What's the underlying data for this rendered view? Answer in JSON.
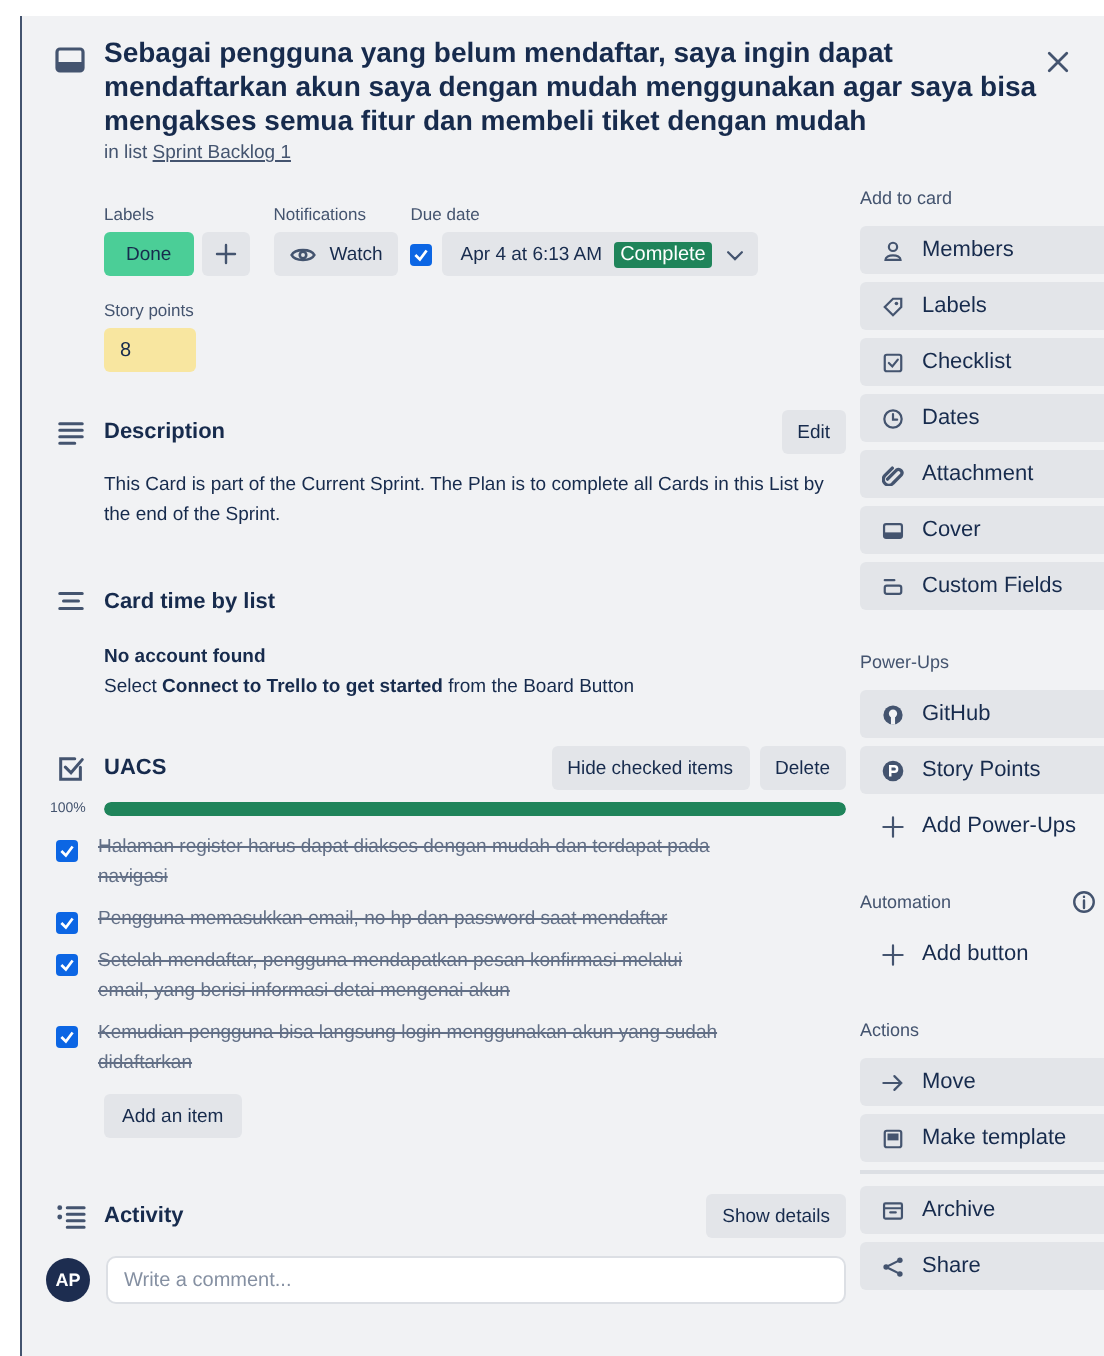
{
  "card": {
    "title": "Sebagai pengguna yang belum mendaftar, saya ingin dapat mendaftarkan akun saya dengan mudah menggunakan agar saya bisa mengakses semua fitur dan membeli tiket dengan mudah",
    "list_prefix": "in list",
    "list_name": "Sprint Backlog 1"
  },
  "labels": {
    "heading": "Labels",
    "items": [
      {
        "text": "Done",
        "color": "#4bce97"
      }
    ]
  },
  "notifications": {
    "heading": "Notifications",
    "button": "Watch"
  },
  "due_date": {
    "heading": "Due date",
    "checked": true,
    "value": "Apr 4 at 6:13 AM",
    "status": "Complete"
  },
  "story_points": {
    "heading": "Story points",
    "value": "8"
  },
  "description": {
    "heading": "Description",
    "button": "Edit",
    "text": "This Card is part of the Current Sprint. The Plan is to complete all Cards in this List by the end of the Sprint."
  },
  "card_time": {
    "heading": "Card time by list",
    "title": "No account found",
    "text": "Select **Connect to Trello to get started** from the Board Button"
  },
  "checklist": {
    "heading": "UACS",
    "buttons": [
      "Hide checked items",
      "Delete"
    ],
    "percent": "100%",
    "level": 1,
    "add_button": "Add an item",
    "items": [
      {
        "text": "Halaman register harus dapat diakses dengan mudah dan terdapat pada navigasi",
        "checked": true
      },
      {
        "text": "Pengguna memasukkan email, no hp dan password saat mendaftar",
        "checked": true
      },
      {
        "text": "Setelah mendaftar, pengguna mendapatkan pesan konfirmasi melalui email, yang berisi informasi detai mengenai akun",
        "checked": true
      },
      {
        "text": "Kemudian pengguna bisa langsung login menggunakan akun yang sudah didaftarkan",
        "checked": true
      }
    ]
  },
  "activity": {
    "heading": "Activity",
    "button": "Show details",
    "avatar": "AP",
    "placeholder": "Write a comment..."
  },
  "sidebar": {
    "sections": [
      {
        "heading": "Add to card",
        "info": false,
        "items": [
          {
            "label": "Members",
            "kind": "button"
          },
          {
            "label": "Labels",
            "kind": "button"
          },
          {
            "label": "Checklist",
            "kind": "button"
          },
          {
            "label": "Dates",
            "kind": "button"
          },
          {
            "label": "Attachment",
            "kind": "button"
          },
          {
            "label": "Cover",
            "kind": "button"
          },
          {
            "label": "Custom Fields",
            "kind": "button"
          }
        ]
      },
      {
        "heading": "Power-Ups",
        "info": false,
        "items": [
          {
            "label": "GitHub",
            "kind": "button"
          },
          {
            "label": "Story Points",
            "kind": "button"
          },
          {
            "label": "Add Power-Ups",
            "kind": "plain"
          }
        ]
      },
      {
        "heading": "Automation",
        "info": true,
        "items": [
          {
            "label": "Add button",
            "kind": "plain"
          }
        ]
      },
      {
        "heading": "Actions",
        "info": false,
        "items": [
          {
            "label": "Move",
            "kind": "button"
          },
          {
            "label": "Make template",
            "kind": "button"
          },
          {
            "kind": "divider"
          },
          {
            "label": "Archive",
            "kind": "button"
          },
          {
            "label": "Share",
            "kind": "button"
          }
        ]
      }
    ]
  }
}
